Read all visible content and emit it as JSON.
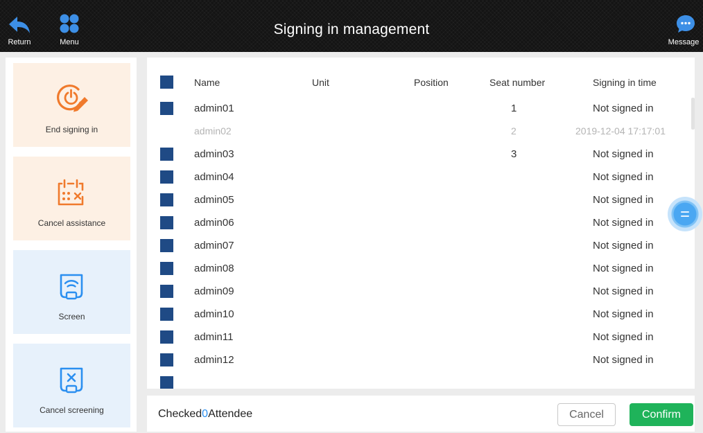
{
  "header": {
    "title": "Signing in management",
    "return_label": "Return",
    "menu_label": "Menu",
    "message_label": "Message"
  },
  "sidebar": {
    "items": [
      {
        "label": "End signing in",
        "icon": "power-pen-icon",
        "theme": "orange"
      },
      {
        "label": "Cancel assistance",
        "icon": "calendar-cancel-icon",
        "theme": "orange"
      },
      {
        "label": "Screen",
        "icon": "screen-cast-icon",
        "theme": "blue"
      },
      {
        "label": "Cancel screening",
        "icon": "screen-cancel-icon",
        "theme": "blue"
      }
    ]
  },
  "table": {
    "columns": [
      "Name",
      "Unit",
      "Position",
      "Seat number",
      "Signing in time"
    ],
    "rows": [
      {
        "name": "admin01",
        "unit": "",
        "position": "",
        "seat": "1",
        "time": "Not signed in",
        "checkable": true
      },
      {
        "name": "admin02",
        "unit": "",
        "position": "",
        "seat": "2",
        "time": "2019-12-04 17:17:01",
        "checkable": false
      },
      {
        "name": "admin03",
        "unit": "",
        "position": "",
        "seat": "3",
        "time": "Not signed in",
        "checkable": true
      },
      {
        "name": "admin04",
        "unit": "",
        "position": "",
        "seat": "",
        "time": "Not signed in",
        "checkable": true
      },
      {
        "name": "admin05",
        "unit": "",
        "position": "",
        "seat": "",
        "time": "Not signed in",
        "checkable": true
      },
      {
        "name": "admin06",
        "unit": "",
        "position": "",
        "seat": "",
        "time": "Not signed in",
        "checkable": true
      },
      {
        "name": "admin07",
        "unit": "",
        "position": "",
        "seat": "",
        "time": "Not signed in",
        "checkable": true
      },
      {
        "name": "admin08",
        "unit": "",
        "position": "",
        "seat": "",
        "time": "Not signed in",
        "checkable": true
      },
      {
        "name": "admin09",
        "unit": "",
        "position": "",
        "seat": "",
        "time": "Not signed in",
        "checkable": true
      },
      {
        "name": "admin10",
        "unit": "",
        "position": "",
        "seat": "",
        "time": "Not signed in",
        "checkable": true
      },
      {
        "name": "admin11",
        "unit": "",
        "position": "",
        "seat": "",
        "time": "Not signed in",
        "checkable": true
      },
      {
        "name": "admin12",
        "unit": "",
        "position": "",
        "seat": "",
        "time": "Not signed in",
        "checkable": true
      }
    ]
  },
  "footer": {
    "checked_prefix": "Checked",
    "checked_count": "0",
    "checked_suffix": "Attendee",
    "cancel_label": "Cancel",
    "confirm_label": "Confirm"
  },
  "colors": {
    "accent_blue": "#1f4a85",
    "confirm_green": "#1fb35a",
    "icon_orange": "#f07a2c",
    "icon_blue": "#2b8ff0",
    "count_blue": "#2b8ff0"
  }
}
